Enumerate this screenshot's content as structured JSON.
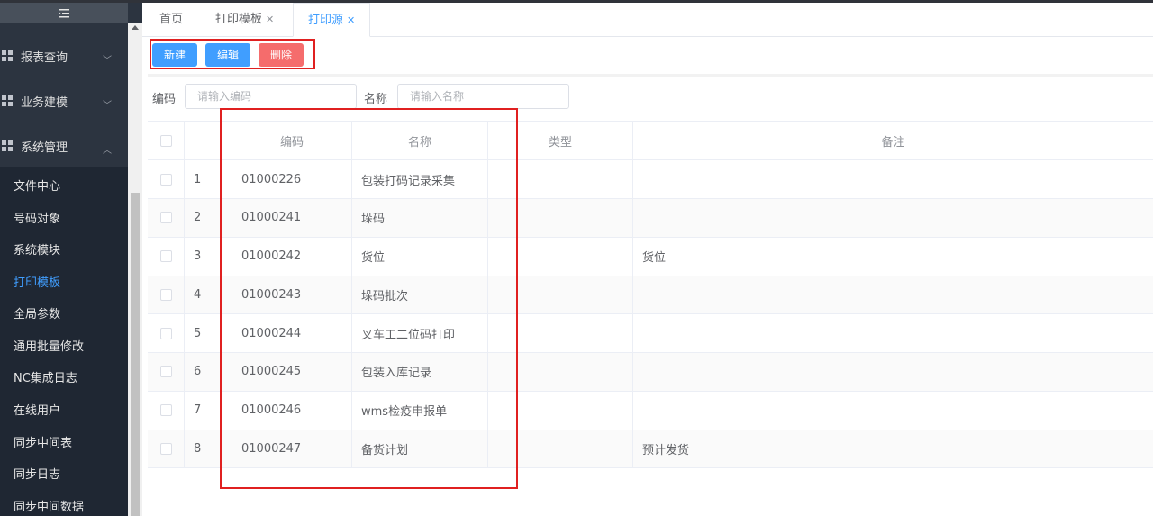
{
  "sidebar": {
    "collapse_icon": "menu-fold-icon",
    "groups": [
      {
        "label": "报表查询",
        "icon": "grid-icon",
        "arrow": "﹀"
      },
      {
        "label": "业务建模",
        "icon": "grid-icon",
        "arrow": "﹀"
      },
      {
        "label": "系统管理",
        "icon": "grid-icon",
        "arrow": "︿"
      }
    ],
    "items": [
      {
        "label": "文件中心"
      },
      {
        "label": "号码对象"
      },
      {
        "label": "系统模块"
      },
      {
        "label": "打印模板"
      },
      {
        "label": "全局参数"
      },
      {
        "label": "通用批量修改"
      },
      {
        "label": "NC集成日志"
      },
      {
        "label": "在线用户"
      },
      {
        "label": "同步中间表"
      },
      {
        "label": "同步日志"
      },
      {
        "label": "同步中间数据"
      }
    ],
    "active_item": "打印模板"
  },
  "tabs": [
    {
      "label": "首页",
      "closable": false
    },
    {
      "label": "打印模板",
      "closable": true,
      "close": "✕"
    },
    {
      "label": "打印源",
      "closable": true,
      "close": "✕",
      "active": true
    }
  ],
  "toolbar": {
    "new_label": "新建",
    "edit_label": "编辑",
    "delete_label": "删除"
  },
  "filters": {
    "code_label": "编码",
    "code_placeholder": "请输入编码",
    "name_label": "名称",
    "name_placeholder": "请输入名称"
  },
  "table": {
    "headers": [
      "",
      "",
      "编码",
      "名称",
      "类型",
      "备注"
    ],
    "rows": [
      {
        "index": "1",
        "code": "01000226",
        "name": "包装打码记录采集",
        "type": "",
        "remark": ""
      },
      {
        "index": "2",
        "code": "01000241",
        "name": "垛码",
        "type": "",
        "remark": ""
      },
      {
        "index": "3",
        "code": "01000242",
        "name": "货位",
        "type": "",
        "remark": "货位"
      },
      {
        "index": "4",
        "code": "01000243",
        "name": "垛码批次",
        "type": "",
        "remark": ""
      },
      {
        "index": "5",
        "code": "01000244",
        "name": "叉车工二位码打印",
        "type": "",
        "remark": ""
      },
      {
        "index": "6",
        "code": "01000245",
        "name": "包装入库记录",
        "type": "",
        "remark": ""
      },
      {
        "index": "7",
        "code": "01000246",
        "name": "wms检疫申报单",
        "type": "",
        "remark": ""
      },
      {
        "index": "8",
        "code": "01000247",
        "name": "备货计划",
        "type": "",
        "remark": "预计发货"
      }
    ]
  },
  "colors": {
    "sidebar_bg": "#2c3440",
    "submenu_bg": "#1f2733",
    "primary": "#409eff",
    "danger": "#f56c6c",
    "highlight_border": "#e02020"
  }
}
